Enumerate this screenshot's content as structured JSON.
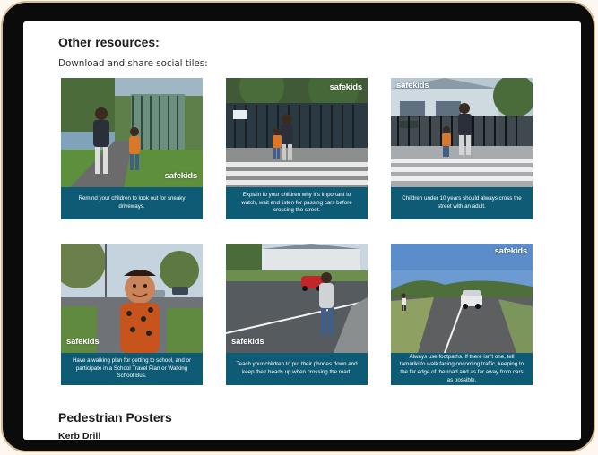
{
  "resources": {
    "heading": "Other resources:",
    "intro": "Download and share social tiles:",
    "tiles": [
      {
        "brand": "safekids",
        "caption": "Remind your children to look out for sneaky driveways."
      },
      {
        "brand": "safekids",
        "caption": "Explain to your children why it's important to watch, wait and listen for passing cars before crossing the street."
      },
      {
        "brand": "safekids",
        "caption": "Children under 10 years should always cross the street with an adult."
      },
      {
        "brand": "safekids",
        "caption": "Have a walking plan for getting to school, and or participate in a School Travel Plan or Walking School Bus."
      },
      {
        "brand": "safekids",
        "caption": "Teach your children to put their phones down and keep their heads up when crossing the road."
      },
      {
        "brand": "safekids",
        "caption": "Always use footpaths. If there isn't one, tell tamariki to walk facing oncoming traffic, keeping to the far edge of the road and as far away from cars as possible."
      }
    ]
  },
  "posters": {
    "heading": "Pedestrian Posters",
    "first_item": "Kerb Drill"
  },
  "colors": {
    "caption_bg": "#0e5b76",
    "device_frame": "#0b0b0b",
    "page_bg": "#ffffff"
  }
}
